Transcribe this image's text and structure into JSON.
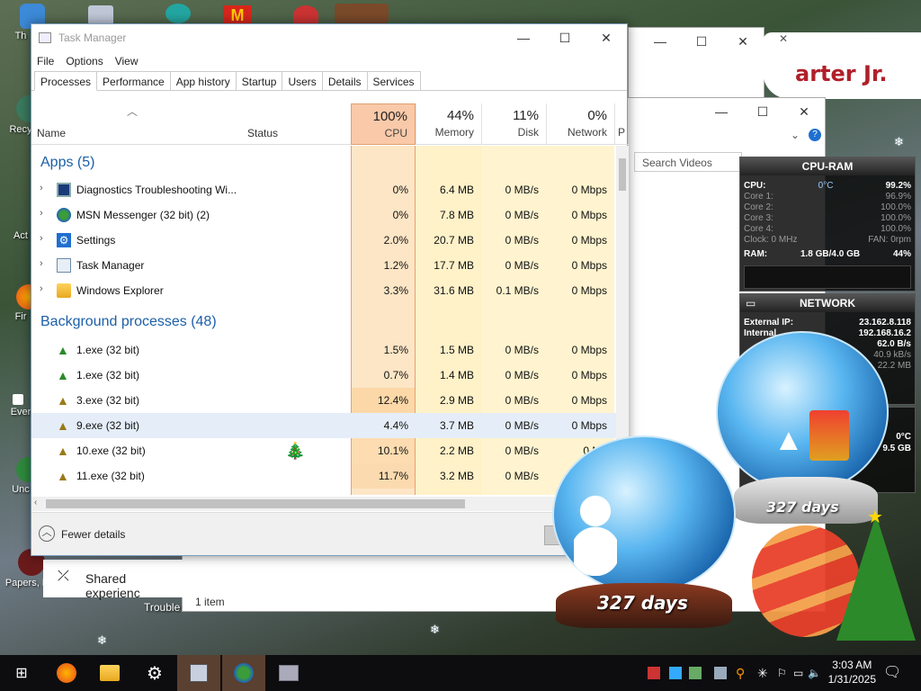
{
  "desktop": {
    "icons": [
      {
        "label": "Th"
      },
      {
        "label": "Recy"
      },
      {
        "label": "Act"
      },
      {
        "label": "Fir"
      },
      {
        "label": "Ever"
      },
      {
        "label": "Unc"
      },
      {
        "label": "Papers, P"
      }
    ],
    "bg_text": "arter Jr.",
    "shared_label": "Shared experienc",
    "trouble_label": "Trouble",
    "items_label": "1 item",
    "search_placeholder": "Search Videos"
  },
  "task_manager": {
    "title": "Task Manager",
    "menu": [
      "File",
      "Options",
      "View"
    ],
    "tabs": [
      "Processes",
      "Performance",
      "App history",
      "Startup",
      "Users",
      "Details",
      "Services"
    ],
    "active_tab": "Processes",
    "columns": {
      "name": "Name",
      "status": "Status",
      "cpu": {
        "pct": "100%",
        "label": "CPU"
      },
      "memory": {
        "pct": "44%",
        "label": "Memory"
      },
      "disk": {
        "pct": "11%",
        "label": "Disk"
      },
      "network": {
        "pct": "0%",
        "label": "Network"
      },
      "power": "P"
    },
    "groups": {
      "apps": "Apps (5)",
      "background": "Background processes (48)"
    },
    "apps": [
      {
        "name": "Diagnostics Troubleshooting Wi...",
        "cpu": "0%",
        "mem": "6.4 MB",
        "disk": "0 MB/s",
        "net": "0 Mbps",
        "icon": "diagnostics-icon"
      },
      {
        "name": "MSN Messenger (32 bit) (2)",
        "cpu": "0%",
        "mem": "7.8 MB",
        "disk": "0 MB/s",
        "net": "0 Mbps",
        "icon": "msn-icon"
      },
      {
        "name": "Settings",
        "cpu": "2.0%",
        "mem": "20.7 MB",
        "disk": "0 MB/s",
        "net": "0 Mbps",
        "icon": "settings-icon"
      },
      {
        "name": "Task Manager",
        "cpu": "1.2%",
        "mem": "17.7 MB",
        "disk": "0 MB/s",
        "net": "0 Mbps",
        "icon": "task-manager-icon"
      },
      {
        "name": "Windows Explorer",
        "cpu": "3.3%",
        "mem": "31.6 MB",
        "disk": "0.1 MB/s",
        "net": "0 Mbps",
        "icon": "folder-icon"
      }
    ],
    "background": [
      {
        "name": "1.exe (32 bit)",
        "cpu": "1.5%",
        "mem": "1.5 MB",
        "disk": "0 MB/s",
        "net": "0 Mbps"
      },
      {
        "name": "1.exe (32 bit)",
        "cpu": "0.7%",
        "mem": "1.4 MB",
        "disk": "0 MB/s",
        "net": "0 Mbps"
      },
      {
        "name": "3.exe (32 bit)",
        "cpu": "12.4%",
        "mem": "2.9 MB",
        "disk": "0 MB/s",
        "net": "0 Mbps"
      },
      {
        "name": "9.exe (32 bit)",
        "cpu": "4.4%",
        "mem": "3.7 MB",
        "disk": "0 MB/s",
        "net": "0 Mbps"
      },
      {
        "name": "10.exe (32 bit)",
        "cpu": "10.1%",
        "mem": "2.2 MB",
        "disk": "0 MB/s",
        "net": "0 Mb"
      },
      {
        "name": "11.exe (32 bit)",
        "cpu": "11.7%",
        "mem": "3.2 MB",
        "disk": "0 MB/s",
        "net": ""
      }
    ],
    "fewer_details": "Fewer details"
  },
  "cpu_gadget": {
    "title": "CPU-RAM",
    "cpu_label": "CPU:",
    "cpu_temp": "0°C",
    "cpu_val": "99.2%",
    "cores": [
      {
        "label": "Core 1:",
        "val": "96.9%"
      },
      {
        "label": "Core 2:",
        "val": "100.0%"
      },
      {
        "label": "Core 3:",
        "val": "100.0%"
      },
      {
        "label": "Core 4:",
        "val": "100.0%"
      }
    ],
    "clock_label": "Clock: 0 MHz",
    "fan_label": "FAN: 0rpm",
    "ram_label": "RAM:",
    "ram_val": "1.8 GB/4.0 GB",
    "ram_pct": "44%"
  },
  "net_gadget": {
    "title": "NETWORK",
    "ext_label": "External IP:",
    "ext_val": "23.162.8.118",
    "int_label": "Internal",
    "int_val": "192.168.16.2",
    "r_val": "62.0 B/s",
    "s_val": "40.9 kB/s",
    "t_val": "22.2 MB"
  },
  "drive_gadget": {
    "temp": "0°C",
    "size": "9.5 GB"
  },
  "globes": {
    "left_days": "327 days",
    "right_days": "327 days"
  },
  "taskbar": {
    "time": "3:03 AM",
    "date": "1/31/2025"
  },
  "colors": {
    "cpu_header": "#f9c9a9",
    "heat_light": "#fff4c4",
    "heat_mid": "#ffe9a8",
    "group_blue": "#1c5fa8"
  }
}
